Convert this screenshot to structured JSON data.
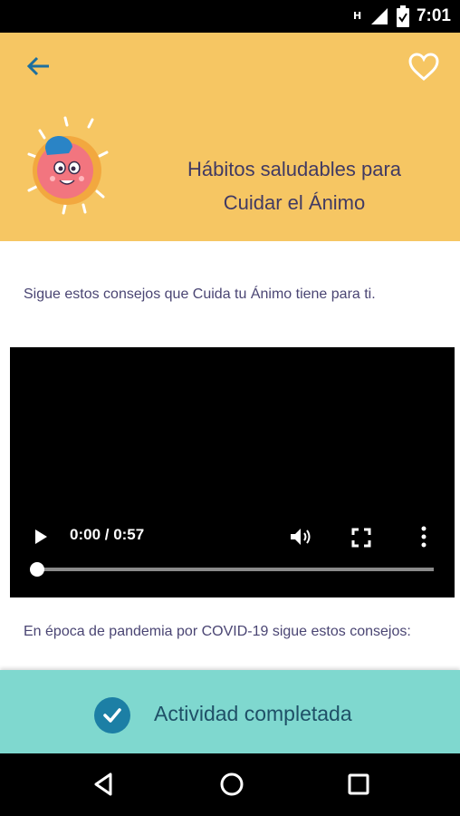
{
  "status_bar": {
    "time": "7:01",
    "icons": [
      "network-h-icon",
      "signal-icon",
      "battery-icon"
    ]
  },
  "header": {
    "back_icon": "arrow-left-icon",
    "favorite_icon": "heart-outline-icon",
    "mascot": "smiling-face-mascot",
    "title_line1": "Hábitos saludables para",
    "title_line2": "Cuidar el Ánimo",
    "background_color": "#f6c663"
  },
  "content": {
    "intro": "Sigue estos consejos que Cuida tu Ánimo tiene para ti.",
    "pandemic_text": "En época de pandemia por COVID-19 sigue estos consejos:"
  },
  "video": {
    "time_display": "0:00 / 0:57",
    "progress_fraction": 0,
    "controls": [
      "play-icon",
      "volume-icon",
      "fullscreen-icon",
      "more-vert-icon"
    ]
  },
  "completion": {
    "label": "Actividad completada",
    "icon": "check-circle-icon",
    "bar_color": "#7fd8cf",
    "check_color": "#1c7fa5"
  },
  "nav_bar": {
    "buttons": [
      "back-triangle-icon",
      "home-circle-icon",
      "recents-square-icon"
    ]
  }
}
